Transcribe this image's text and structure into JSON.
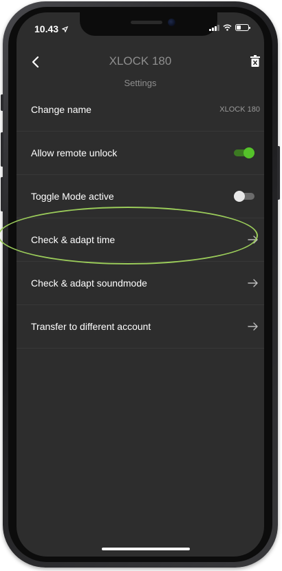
{
  "status_bar": {
    "time": "10.43"
  },
  "header": {
    "title": "XLOCK 180",
    "subtitle": "Settings",
    "back_icon": "chevron-left-icon",
    "delete_icon": "trash-icon"
  },
  "settings": {
    "change_name": {
      "label": "Change name",
      "value": "XLOCK 180"
    },
    "remote_unlock": {
      "label": "Allow remote unlock",
      "enabled": true
    },
    "toggle_mode": {
      "label": "Toggle Mode active",
      "enabled": false
    },
    "adapt_time": {
      "label": "Check & adapt time"
    },
    "adapt_soundmode": {
      "label": "Check & adapt soundmode"
    },
    "transfer_account": {
      "label": "Transfer to different account"
    }
  },
  "colors": {
    "background": "#2d2d2d",
    "toggle_on": "#55c22a",
    "toggle_off": "#e8e8e8",
    "highlight": "#9bcc5a"
  }
}
